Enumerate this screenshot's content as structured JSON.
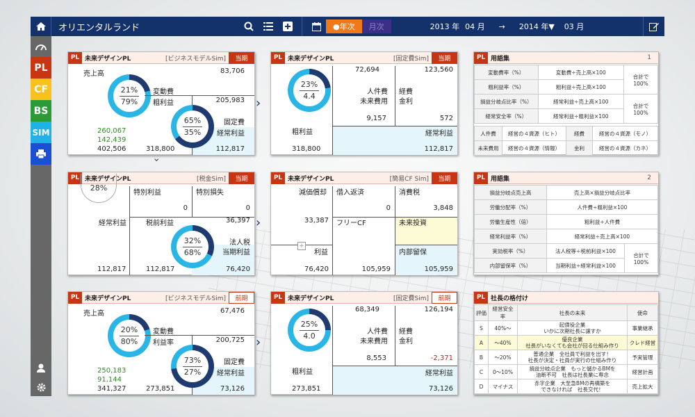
{
  "header": {
    "title": "オリエンタルランド",
    "year_btn": "●年次",
    "month_btn": "月次",
    "from_year": "2013 年",
    "from_month": "04 月",
    "arrow": "→",
    "to_year": "2014 年▼",
    "to_month": "03 月"
  },
  "sidebar": {
    "items": [
      "PL",
      "CF",
      "BS",
      "SIM"
    ]
  },
  "colors": {
    "navy": "#13326b",
    "accent": "#c83512",
    "orange": "#f07a1a",
    "cyan_ring": "#29b6e6",
    "navy_ring": "#1e3a6e"
  },
  "card1": {
    "tag": "PL",
    "title": "未来デザインPL",
    "sub": "[ビジネスモデルSim]",
    "badge": "当期",
    "sales_label": "売上高",
    "sales": "83,706",
    "pct1": "21%",
    "pct2": "79%",
    "var_label": "変動費",
    "gross_label": "粗利益",
    "gross": "205,983",
    "fixed_label": "固定費",
    "pct3": "65%",
    "pct4": "35%",
    "ord_label": "経常利益",
    "g1": "260,067",
    "g2": "142,439",
    "v1": "402,506",
    "v2": "318,800",
    "v3": "112,817"
  },
  "card2": {
    "tag": "PL",
    "title": "未来デザインPL",
    "sub": "[固定費Sim]",
    "badge": "当期",
    "a": "72,694",
    "b": "123,560",
    "pct1": "23%",
    "ratio": "4.4",
    "l1": "人件費",
    "l2": "経費",
    "l3": "未来費用",
    "l4": "金利",
    "c": "9,157",
    "d": "572",
    "l5": "粗利益",
    "l6": "経常利益",
    "e": "318,800",
    "f": "112,817"
  },
  "card3": {
    "tag": "PL",
    "title": "未来デザインPL",
    "sub": "[税金Sim]",
    "badge": "当期",
    "pct0": "28%",
    "l1": "特別利益",
    "l2": "特別損失",
    "z1": "0",
    "z2": "0",
    "l3": "経常利益",
    "l4": "税前利益",
    "v1": "36,397",
    "pct1": "32%",
    "pct2": "68%",
    "l5": "法人税",
    "l6": "当期利益",
    "a": "112,817",
    "b": "112,817",
    "c": "76,420"
  },
  "card4": {
    "tag": "PL",
    "title": "未来デザインPL",
    "sub": "[簡易CF Sim]",
    "badge": "当期",
    "l1": "減価償却",
    "l2": "借入返済",
    "l3": "消費税",
    "z": "0",
    "v1": "3,848",
    "v2": "33,387",
    "l4": "フリーCF",
    "l5": "未来投資",
    "l6": "利益",
    "l7": "内部留保",
    "a": "76,420",
    "b": "105,959",
    "c": "105,959",
    "plus": "+"
  },
  "card5": {
    "tag": "PL",
    "title": "未来デザインPL",
    "sub": "[ビジネスモデルSim]",
    "badge": "前期",
    "sales_label": "売上高",
    "sales": "67,476",
    "pct1": "20%",
    "pct2": "80%",
    "var_label": "変動費",
    "rate_label": "利益率",
    "rate": "200,725",
    "fixed_label": "固定費",
    "pct3": "73%",
    "pct4": "27%",
    "ord_label": "経常利益",
    "g1": "250,183",
    "g2": "91,144",
    "v1": "341,327",
    "v2": "273,851",
    "v3": "73,126"
  },
  "card6": {
    "tag": "PL",
    "title": "未来デザインPL",
    "sub": "[固定費Sim]",
    "badge": "前期",
    "a": "68,349",
    "b": "126,194",
    "pct1": "25%",
    "ratio": "4.0",
    "l1": "人件費",
    "l2": "経費",
    "l3": "未来費用",
    "l4": "金利",
    "c": "8,553",
    "d": "-2,371",
    "l5": "粗利益",
    "l6": "経常利益",
    "e": "273,851",
    "f": "73,126"
  },
  "gloss1": {
    "tag": "PL",
    "title": "用語集",
    "num": "1",
    "rows": [
      [
        "変動費率（%）",
        "変動費÷売上高×100"
      ],
      [
        "粗利益率（%）",
        "粗利益÷売上高×100"
      ],
      [
        "損益分岐点比率（%）",
        "経常利益÷売上高×100"
      ],
      [
        "経常安全率（%）",
        "経常利益÷粗利益×100"
      ]
    ],
    "note": "合計で100%",
    "bottom": [
      [
        "人件費",
        "経営の４資源（ヒト）",
        "経費",
        "経営の４資源（モノ）"
      ],
      [
        "未来費用",
        "経営の４資源（情報）",
        "金利",
        "経営の４資源（カネ）"
      ]
    ]
  },
  "gloss2": {
    "tag": "PL",
    "title": "用語集",
    "num": "2",
    "rows": [
      [
        "損益分岐点売上高",
        "売上高×損益分岐点比率"
      ],
      [
        "労働分配率（%）",
        "人件費÷粗利益×100"
      ],
      [
        "労働生産性（倍）",
        "粗利益÷人件費"
      ],
      [
        "経常利益率（%）",
        "経常利益÷売上高×100"
      ],
      [
        "実効税率（%）",
        "法人税等÷税前利益×100"
      ],
      [
        "内部留保率（%）",
        "当期利益÷経常利益×100"
      ]
    ],
    "note": "合計で100%"
  },
  "rank": {
    "tag": "PL",
    "title": "社長の格付け",
    "headers": [
      "評価",
      "経営安全率",
      "社長の未来",
      "使命"
    ],
    "rows": [
      [
        "S",
        "40%～",
        "起債役企業\nいかに次期社長に譲すか",
        "事業継承"
      ],
      [
        "A",
        "～40%",
        "優良企業\n社長がいなくても会社が回る仕組み作り",
        "クレド経営"
      ],
      [
        "B",
        "～20%",
        "普通企業　全社員で利益を出す！\n社長が決定・社員が実行の仕組み作り",
        "予実管理"
      ],
      [
        "C",
        "0～10%",
        "損益分岐点企業　もっと儲かるBMを\n油断不可　社長は社長業に専念",
        "経営計画"
      ],
      [
        "D",
        "マイナス",
        "赤字企業　大至急BMの再構築を\nできなければ　社長交代！",
        "売上拡大"
      ]
    ]
  }
}
